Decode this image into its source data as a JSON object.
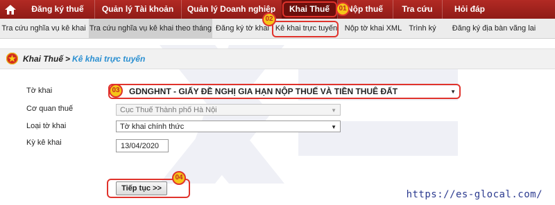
{
  "nav": {
    "items": [
      {
        "label": "Đăng ký thuế"
      },
      {
        "label": "Quản lý Tài khoản"
      },
      {
        "label": "Quản lý Doanh nghiệp"
      },
      {
        "label": "Khai Thuế"
      },
      {
        "label": "Nộp thuế"
      },
      {
        "label": "Tra cứu"
      },
      {
        "label": "Hỏi đáp"
      }
    ],
    "active": "Khai Thuế"
  },
  "subnav": {
    "items": [
      {
        "label": "Tra cứu nghĩa vụ kê khai"
      },
      {
        "label": "Tra cứu nghĩa vụ kê khai theo tháng"
      },
      {
        "label": "Đăng ký tờ khai"
      },
      {
        "label": "Kê khai trực tuyến"
      },
      {
        "label": "Nộp tờ khai XML"
      },
      {
        "label": "Trình ký"
      },
      {
        "label": "Đăng ký địa bàn vãng lai"
      }
    ]
  },
  "breadcrumb": {
    "parent": "Khai Thuế",
    "separator": ">",
    "current": "Kê khai trực tuyến"
  },
  "form": {
    "to_khai": {
      "label": "Tờ khai",
      "value": "GDNGHNT - GIẤY ĐỀ NGHỊ GIA HẠN NỘP THUẾ VÀ TIỀN THUÊ ĐẤT"
    },
    "co_quan_thue": {
      "label": "Cơ quan thuế",
      "value": "Cục Thuế Thành phố Hà Nội"
    },
    "loai_to_khai": {
      "label": "Loại tờ khai",
      "value": "Tờ khai chính thức"
    },
    "ky_ke_khai": {
      "label": "Kỳ kê khai",
      "value": "13/04/2020"
    },
    "submit_label": "Tiếp tục >>"
  },
  "badges": {
    "b1": "01",
    "b2": "02",
    "b3": "03",
    "b4": "04"
  },
  "watermark": {
    "url": "https://es-glocal.com/"
  },
  "colors": {
    "nav_bg": "#9c1f1f",
    "highlight": "#e0332c",
    "badge": "#f5c518",
    "link": "#2a8fd1"
  }
}
